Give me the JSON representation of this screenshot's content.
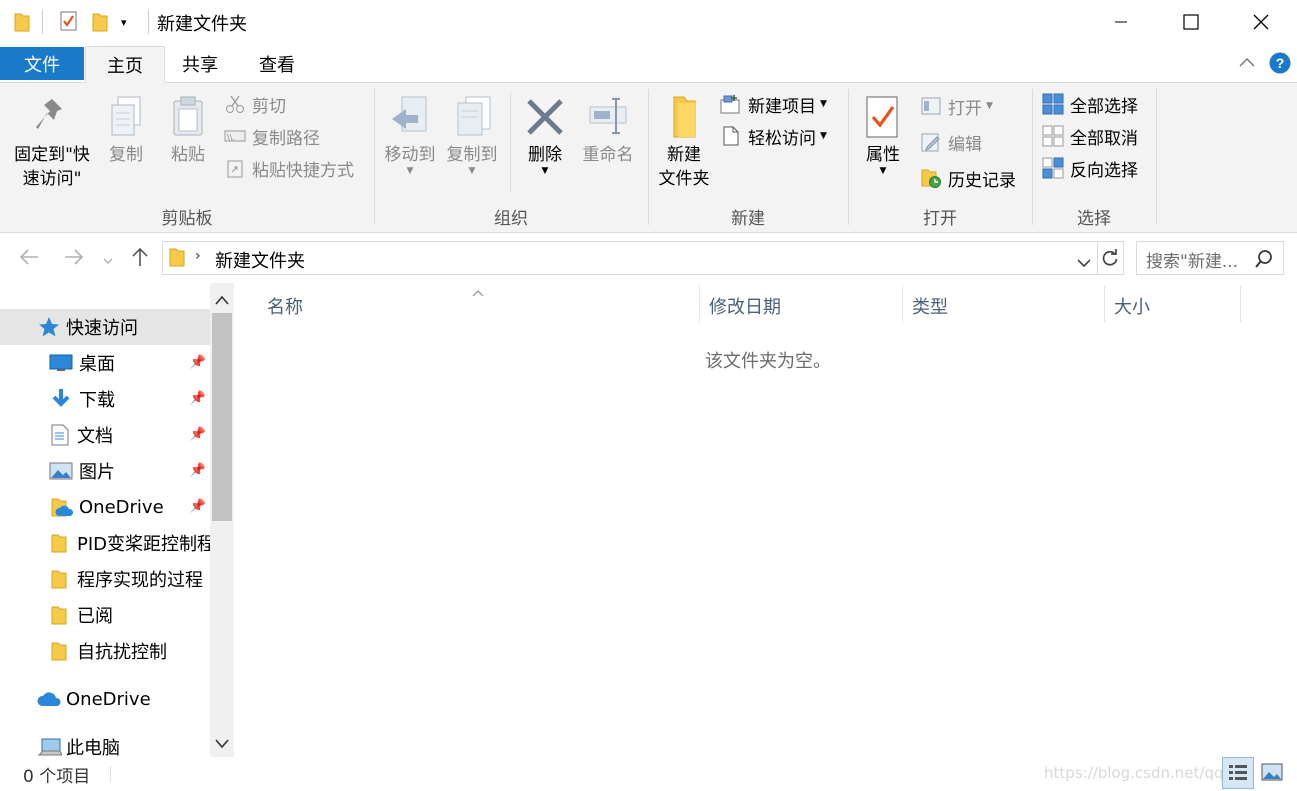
{
  "window": {
    "title": "新建文件夹",
    "controls": {
      "minimize": "—",
      "maximize": "☐",
      "close": "✕"
    }
  },
  "tabs": [
    {
      "label": "文件"
    },
    {
      "label": "主页"
    },
    {
      "label": "共享"
    },
    {
      "label": "查看"
    }
  ],
  "ribbon": {
    "clipboard": {
      "group_label": "剪贴板",
      "pin_label": "固定到\"快\n速访问\"",
      "copy_label": "复制",
      "paste_label": "粘贴",
      "cut_label": "剪切",
      "copy_path_label": "复制路径",
      "paste_shortcut_label": "粘贴快捷方式"
    },
    "organize": {
      "group_label": "组织",
      "move_to_label": "移动到",
      "copy_to_label": "复制到",
      "delete_label": "删除",
      "rename_label": "重命名"
    },
    "new": {
      "group_label": "新建",
      "new_folder_label": "新建\n文件夹",
      "new_item_label": "新建项目",
      "easy_access_label": "轻松访问"
    },
    "open": {
      "group_label": "打开",
      "properties_label": "属性",
      "open_label": "打开",
      "edit_label": "编辑",
      "history_label": "历史记录"
    },
    "select": {
      "group_label": "选择",
      "select_all_label": "全部选择",
      "select_none_label": "全部取消",
      "invert_label": "反向选择"
    }
  },
  "address": {
    "breadcrumb": "新建文件夹",
    "search_placeholder": "搜索\"新建..."
  },
  "nav": {
    "items": [
      {
        "label": "快速访问",
        "icon": "star-icon",
        "pinned": false
      },
      {
        "label": "桌面",
        "icon": "desktop-icon",
        "pinned": true
      },
      {
        "label": "下载",
        "icon": "download-icon",
        "pinned": true
      },
      {
        "label": "文档",
        "icon": "document-icon",
        "pinned": true
      },
      {
        "label": "图片",
        "icon": "picture-icon",
        "pinned": true
      },
      {
        "label": "OneDrive",
        "icon": "onedrive-folder-icon",
        "pinned": true
      },
      {
        "label": "PID变桨距控制程",
        "icon": "folder-icon",
        "pinned": false
      },
      {
        "label": "程序实现的过程",
        "icon": "folder-icon",
        "pinned": false
      },
      {
        "label": "已阅",
        "icon": "folder-icon",
        "pinned": false
      },
      {
        "label": "自抗扰控制",
        "icon": "folder-icon",
        "pinned": false
      }
    ],
    "onedrive": "OneDrive",
    "this_pc": "此电脑"
  },
  "columns": {
    "name": "名称",
    "modified": "修改日期",
    "type": "类型",
    "size": "大小"
  },
  "content": {
    "empty_message": "该文件夹为空。"
  },
  "status": {
    "item_count": "0 个项目",
    "watermark": "https://blog.csdn.net/qq_"
  },
  "colors": {
    "accent": "#1979ca",
    "ribbon_bg": "#f3f3f3",
    "folder_yellow": "#f7c948",
    "selected_bg": "#e5e5e5"
  }
}
